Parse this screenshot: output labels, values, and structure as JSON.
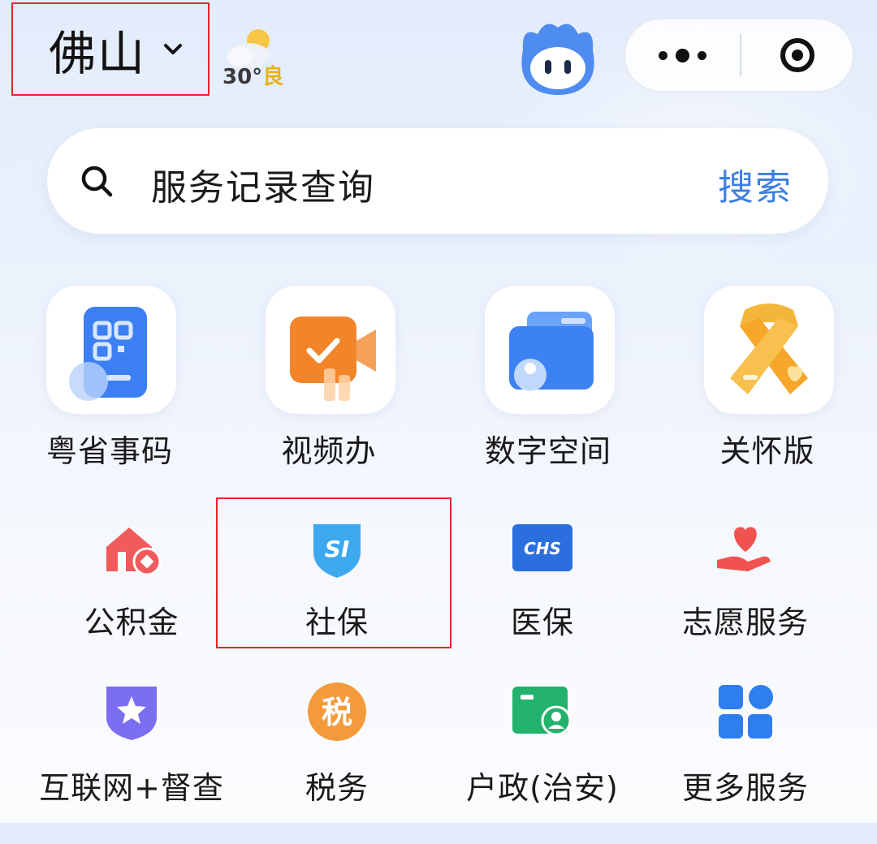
{
  "header": {
    "city": "佛山",
    "weather": {
      "temp": "30°",
      "quality": "良"
    }
  },
  "search": {
    "placeholder": "服务记录查询",
    "button": "搜索"
  },
  "featured": [
    {
      "label": "粤省事码",
      "icon": "qr-code-card-icon"
    },
    {
      "label": "视频办",
      "icon": "video-camera-icon"
    },
    {
      "label": "数字空间",
      "icon": "digital-wallet-icon"
    },
    {
      "label": "关怀版",
      "icon": "ribbon-heart-icon"
    }
  ],
  "services": [
    {
      "label": "公积金",
      "icon": "house-coin-icon",
      "color": "#f15b5b"
    },
    {
      "label": "社保",
      "icon": "si-shield-icon",
      "color": "#3da8ee"
    },
    {
      "label": "医保",
      "icon": "chs-card-icon",
      "color": "#2b6fde"
    },
    {
      "label": "志愿服务",
      "icon": "heart-hand-icon",
      "color": "#f0534f"
    },
    {
      "label": "互联网+督查",
      "icon": "star-shield-icon",
      "color": "#7b6ef0"
    },
    {
      "label": "税务",
      "icon": "tax-badge-icon",
      "color": "#f39a3b"
    },
    {
      "label": "户政(治安)",
      "icon": "household-id-icon",
      "color": "#22b26b"
    },
    {
      "label": "更多服务",
      "icon": "grid-apps-icon",
      "color": "#2f7ef0"
    }
  ],
  "tax_glyph": "税",
  "si_glyph": "SI",
  "chs_glyph": "CHS"
}
